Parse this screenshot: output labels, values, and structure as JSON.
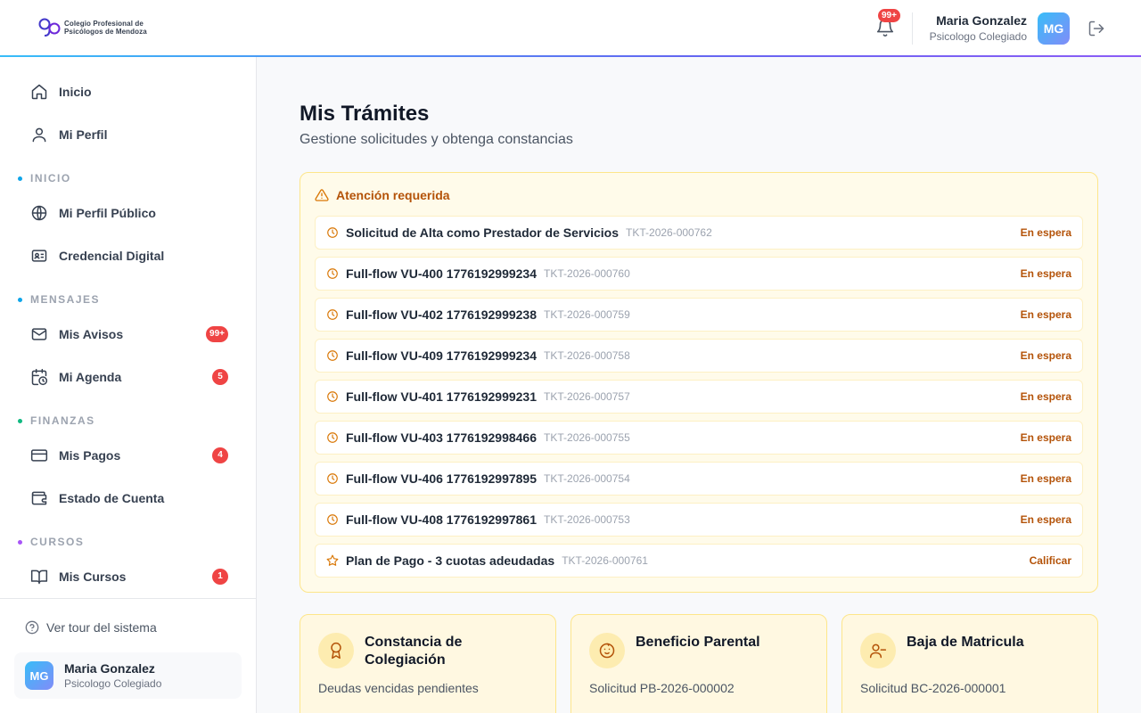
{
  "header": {
    "logo_line1": "Colegio Profesional de",
    "logo_line2": "Psicólogos de Mendoza",
    "notifications_badge": "99+",
    "user_name": "Maria Gonzalez",
    "user_role": "Psicologo Colegiado",
    "avatar_initials": "MG"
  },
  "sidebar": {
    "top_items": [
      {
        "label": "Inicio",
        "icon": "home-icon"
      },
      {
        "label": "Mi Perfil",
        "icon": "user-icon"
      }
    ],
    "sections": [
      {
        "title": "INICIO",
        "dot_color": "#0ea5e9",
        "items": [
          {
            "label": "Mi Perfil Público",
            "icon": "globe-icon"
          },
          {
            "label": "Credencial Digital",
            "icon": "id-card-icon"
          }
        ]
      },
      {
        "title": "MENSAJES",
        "dot_color": "#0ea5e9",
        "items": [
          {
            "label": "Mis Avisos",
            "icon": "mail-icon",
            "badge": "99+"
          },
          {
            "label": "Mi Agenda",
            "icon": "calendar-clock-icon",
            "badge": "5"
          }
        ]
      },
      {
        "title": "FINANZAS",
        "dot_color": "#10b981",
        "items": [
          {
            "label": "Mis Pagos",
            "icon": "credit-card-icon",
            "badge": "4"
          },
          {
            "label": "Estado de Cuenta",
            "icon": "wallet-icon"
          }
        ]
      },
      {
        "title": "CURSOS",
        "dot_color": "#a855f7",
        "items": [
          {
            "label": "Mis Cursos",
            "icon": "book-icon",
            "badge": "1"
          }
        ]
      }
    ],
    "tour_label": "Ver tour del sistema",
    "user_card": {
      "initials": "MG",
      "name": "Maria Gonzalez",
      "role": "Psicologo Colegiado"
    }
  },
  "main": {
    "title": "Mis Trámites",
    "subtitle": "Gestione solicitudes y obtenga constancias",
    "alert": {
      "title": "Atención requerida",
      "tickets": [
        {
          "title": "Solicitud de Alta como Prestador de Servicios",
          "code": "TKT-2026-000762",
          "status": "En espera",
          "icon": "clock-icon"
        },
        {
          "title": "Full-flow VU-400 1776192999234",
          "code": "TKT-2026-000760",
          "status": "En espera",
          "icon": "clock-icon"
        },
        {
          "title": "Full-flow VU-402 1776192999238",
          "code": "TKT-2026-000759",
          "status": "En espera",
          "icon": "clock-icon"
        },
        {
          "title": "Full-flow VU-409 1776192999234",
          "code": "TKT-2026-000758",
          "status": "En espera",
          "icon": "clock-icon"
        },
        {
          "title": "Full-flow VU-401 1776192999231",
          "code": "TKT-2026-000757",
          "status": "En espera",
          "icon": "clock-icon"
        },
        {
          "title": "Full-flow VU-403 1776192998466",
          "code": "TKT-2026-000755",
          "status": "En espera",
          "icon": "clock-icon"
        },
        {
          "title": "Full-flow VU-406 1776192997895",
          "code": "TKT-2026-000754",
          "status": "En espera",
          "icon": "clock-icon"
        },
        {
          "title": "Full-flow VU-408 1776192997861",
          "code": "TKT-2026-000753",
          "status": "En espera",
          "icon": "clock-icon"
        },
        {
          "title": "Plan de Pago - 3 cuotas adeudadas",
          "code": "TKT-2026-000761",
          "status": "Calificar",
          "icon": "star-icon"
        }
      ]
    },
    "cards": [
      {
        "title": "Constancia de Colegiación",
        "desc": "Deudas vencidas pendientes",
        "icon": "award-icon"
      },
      {
        "title": "Beneficio Parental",
        "desc": "Solicitud PB-2026-000002",
        "icon": "baby-icon"
      },
      {
        "title": "Baja de Matricula",
        "desc": "Solicitud BC-2026-000001",
        "icon": "user-minus-icon"
      }
    ]
  }
}
